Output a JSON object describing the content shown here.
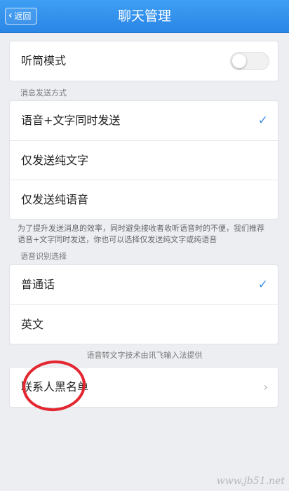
{
  "header": {
    "back_label": "返回",
    "title": "聊天管理"
  },
  "earpiece": {
    "label": "听筒模式",
    "enabled": false
  },
  "send_method": {
    "section_label": "消息发送方式",
    "options": [
      {
        "label": "语音+文字同时发送",
        "selected": true
      },
      {
        "label": "仅发送纯文字",
        "selected": false
      },
      {
        "label": "仅发送纯语音",
        "selected": false
      }
    ],
    "help_text": "为了提升发送消息的效率，同时避免接收者收听语音时的不便，我们推荐语音+文字同时发送，你也可以选择仅发送纯文字或纯语音"
  },
  "speech_recognition": {
    "section_label": "语音识别选择",
    "options": [
      {
        "label": "普通话",
        "selected": true
      },
      {
        "label": "英文",
        "selected": false
      }
    ],
    "footer_note": "语音转文字技术由讯飞输入法提供"
  },
  "blacklist": {
    "label": "联系人黑名单"
  },
  "watermark": "www.jb51.net",
  "colors": {
    "nav_bar": "#2b86e6",
    "check": "#3f8fe6",
    "annotation_circle": "#e3262f"
  }
}
